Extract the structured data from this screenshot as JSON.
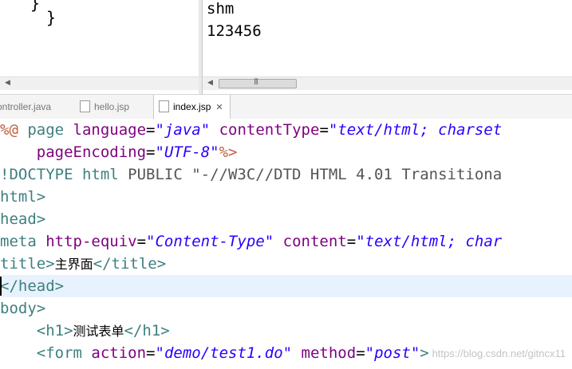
{
  "top_left": {
    "brace": "}"
  },
  "console": {
    "lines": [
      "shm",
      "123456"
    ]
  },
  "tabs": [
    {
      "label": "ontroller.java"
    },
    {
      "label": "hello.jsp"
    },
    {
      "label": "index.jsp",
      "close": "✕"
    }
  ],
  "editor": {
    "lines": [
      {
        "parts": [
          "%@ ",
          "page ",
          "language",
          "=",
          "\"java\"",
          " ",
          "contentType",
          "=",
          "\"text/html; charset"
        ]
      },
      {
        "parts": [
          "    ",
          "pageEncoding",
          "=",
          "\"UTF-8\"",
          "%>"
        ]
      },
      {
        "parts": [
          "!DOCTYPE ",
          "html ",
          "PUBLIC \"-//W3C//DTD HTML 4.01 Transitiona"
        ]
      },
      {
        "parts": [
          "html>"
        ]
      },
      {
        "parts": [
          "head>"
        ]
      },
      {
        "parts": [
          "meta ",
          "http-equiv",
          "=",
          "\"Content-Type\"",
          " ",
          "content",
          "=",
          "\"text/html; char"
        ]
      },
      {
        "parts": [
          "title>",
          "主界面",
          "</title>"
        ]
      },
      {
        "parts": [
          "</head>"
        ]
      },
      {
        "parts": [
          "body>"
        ]
      },
      {
        "parts": [
          "    ",
          "<h1>",
          "测试表单",
          "</h1>"
        ]
      },
      {
        "parts": [
          "    ",
          "<form ",
          "action",
          "=",
          "\"demo/test1.do\"",
          " ",
          "method",
          "=",
          "\"post\"",
          ">"
        ]
      }
    ],
    "watermark": "https://blog.csdn.net/gitncx11"
  }
}
